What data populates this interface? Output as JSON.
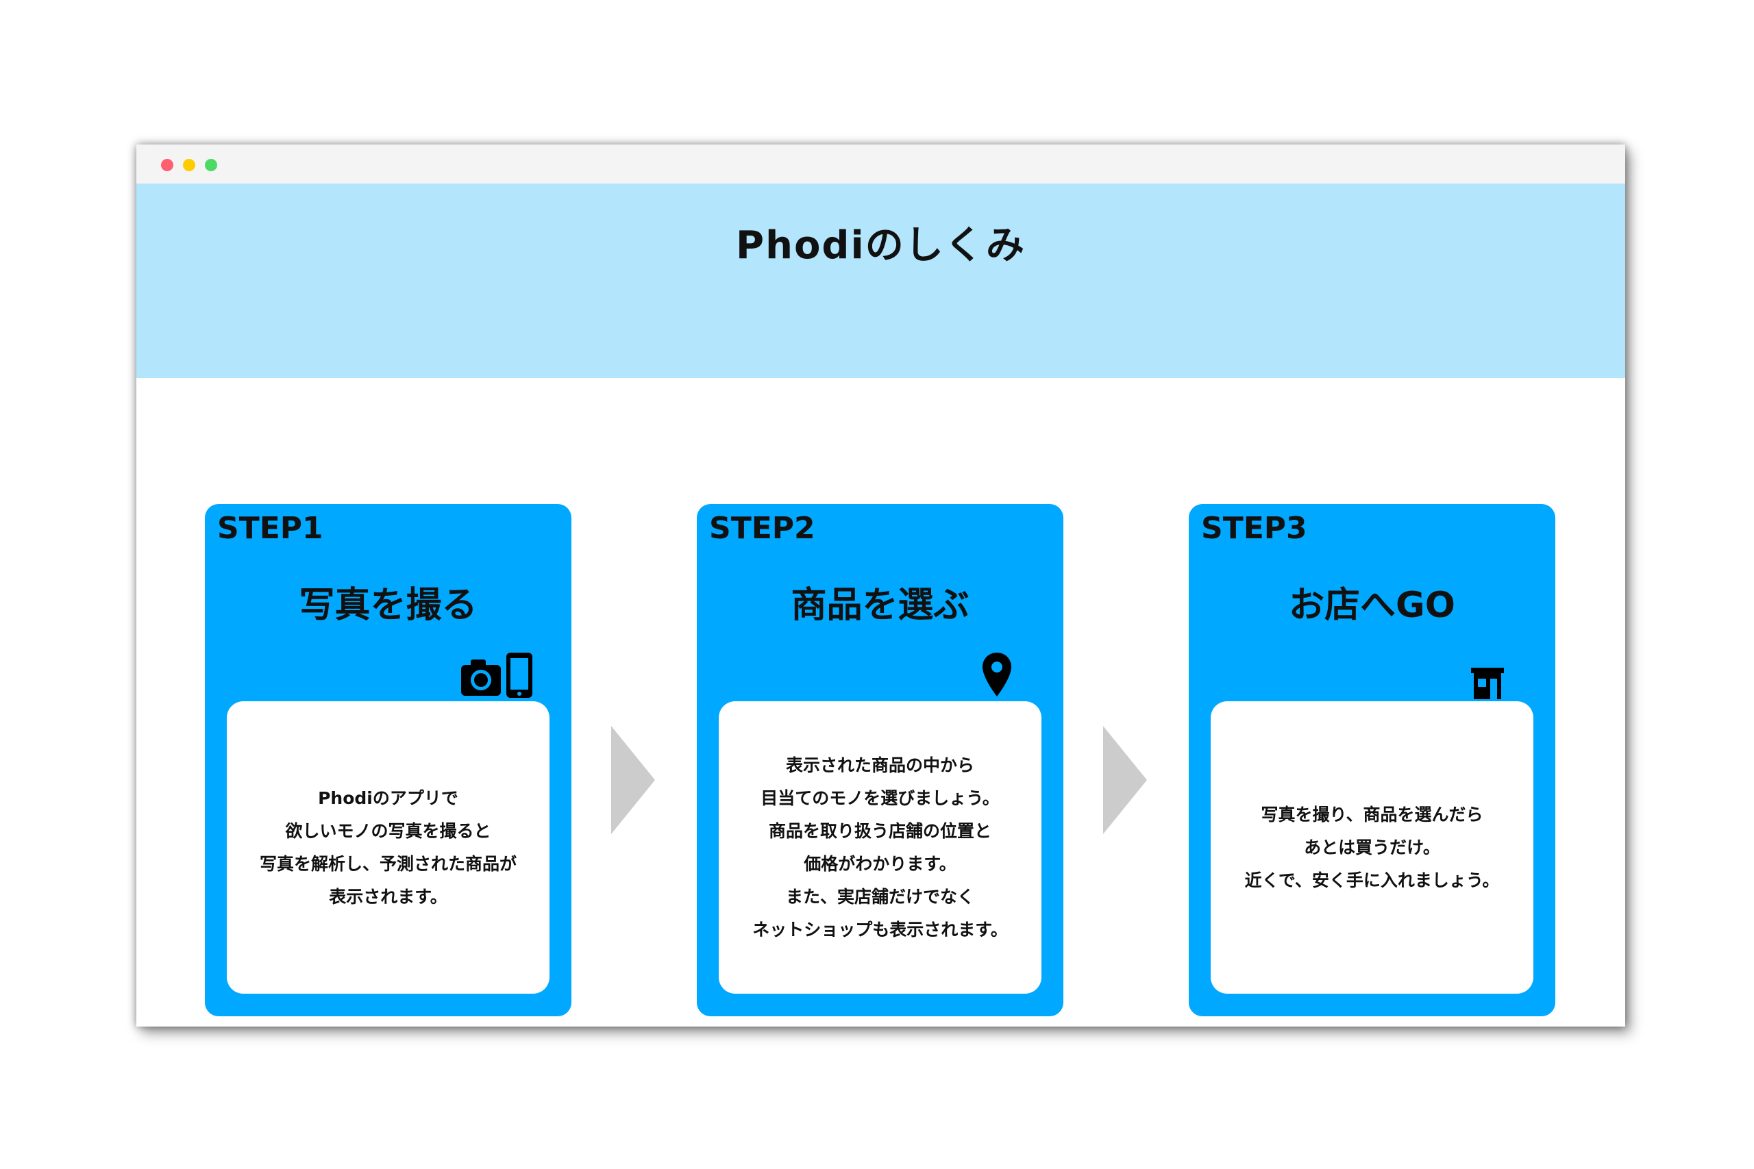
{
  "window": {
    "dots": [
      {
        "name": "close",
        "color": "#ff5f57"
      },
      {
        "name": "minimize",
        "color": "#febc2e"
      },
      {
        "name": "maximize",
        "color": "#28c840"
      }
    ]
  },
  "hero": {
    "title": "Phodiのしくみ",
    "background": "#b3e5fc"
  },
  "steps": [
    {
      "label": "STEP1",
      "title": "写真を撮る",
      "icons": [
        "camera-icon",
        "smartphone-icon"
      ],
      "lines": [
        "Phodiのアプリで",
        "欲しいモノの写真を撮ると",
        "写真を解析し、予測された商品が",
        "表示されます。"
      ]
    },
    {
      "label": "STEP2",
      "title": "商品を選ぶ",
      "icons": [
        "map-pin-icon"
      ],
      "lines": [
        "表示された商品の中から",
        "目当てのモノを選びましょう。",
        "商品を取り扱う店舗の位置と",
        "価格がわかります。",
        "また、実店舗だけでなく",
        "ネットショップも表示されます。"
      ]
    },
    {
      "label": "STEP3",
      "title": "お店へGO",
      "icons": [
        "store-icon"
      ],
      "lines": [
        "写真を撮り、商品を選んだら",
        "あとは買うだけ。",
        "近くで、安く手に入れましょう。"
      ]
    }
  ],
  "colors": {
    "card": "#00a8ff",
    "arrow": "#cccccc",
    "text": "#111111"
  }
}
